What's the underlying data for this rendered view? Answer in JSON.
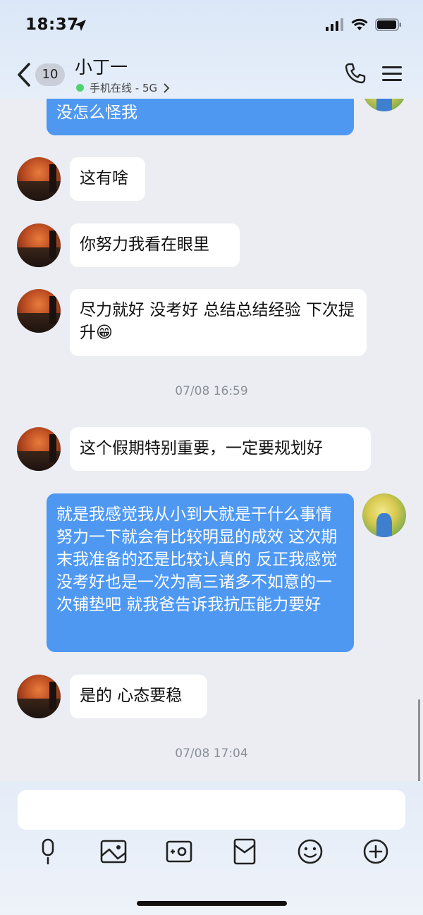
{
  "status": {
    "time": "18:37"
  },
  "header": {
    "back_count": "10",
    "contact_name": "小丁一",
    "online_status": "手机在线 - 5G"
  },
  "messages": [
    {
      "side": "out",
      "text": "没怎么怪我"
    },
    {
      "side": "in",
      "text": "这有啥"
    },
    {
      "side": "in",
      "text": "你努力我看在眼里"
    },
    {
      "side": "in",
      "text": "尽力就好 没考好 总结总结经验 下次提升😁"
    },
    {
      "timestamp": "07/08 16:59"
    },
    {
      "side": "in",
      "text": "这个假期特别重要，一定要规划好"
    },
    {
      "side": "out",
      "text": "就是我感觉我从小到大就是干什么事情努力一下就会有比较明显的成效 这次期末我准备的还是比较认真的 反正我感觉没考好也是一次为高三诸多不如意的一次铺垫吧 就我爸告诉我抗压能力要好"
    },
    {
      "side": "in",
      "text": "是的 心态要稳"
    },
    {
      "timestamp": "07/08 17:04"
    }
  ],
  "input": {
    "value": ""
  },
  "toolbar": {
    "icons": [
      "microphone-icon",
      "image-icon",
      "camera-icon",
      "red-packet-icon",
      "emoji-icon",
      "plus-icon"
    ]
  },
  "colors": {
    "outgoing_bubble": "#4e98f2",
    "incoming_bubble": "#ffffff",
    "background": "#ebedf3"
  }
}
